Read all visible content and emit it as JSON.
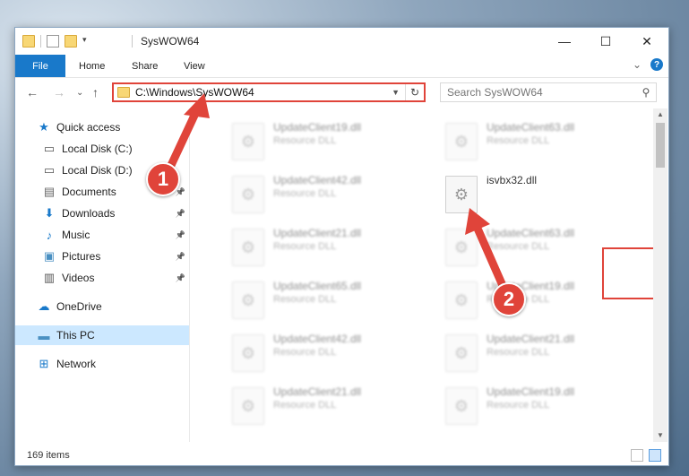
{
  "window": {
    "title": "SysWOW64",
    "controls": {
      "minimize": "—",
      "maximize": "☐",
      "close": "✕"
    }
  },
  "ribbon": {
    "tabs": [
      "File",
      "Home",
      "Share",
      "View"
    ],
    "collapse_glyph": "⌄",
    "help_glyph": "?"
  },
  "navigation": {
    "back": "←",
    "forward": "→",
    "recent": "⌄",
    "up": "↑",
    "address_path": "C:\\Windows\\SysWOW64",
    "search_placeholder": "Search SysWOW64"
  },
  "sidebar": {
    "items": [
      {
        "label": "Quick access",
        "icon": "star-icon",
        "pinned": false
      },
      {
        "label": "Local Disk (C:)",
        "icon": "drive-icon",
        "pinned": false
      },
      {
        "label": "Local Disk (D:)",
        "icon": "drive-icon",
        "pinned": false
      },
      {
        "label": "Documents",
        "icon": "documents-icon",
        "pinned": true
      },
      {
        "label": "Downloads",
        "icon": "download-icon",
        "pinned": true
      },
      {
        "label": "Music",
        "icon": "music-icon",
        "pinned": true
      },
      {
        "label": "Pictures",
        "icon": "pictures-icon",
        "pinned": true
      },
      {
        "label": "Videos",
        "icon": "videos-icon",
        "pinned": true
      },
      {
        "label": "OneDrive",
        "icon": "cloud-icon",
        "pinned": false
      },
      {
        "label": "This PC",
        "icon": "computer-icon",
        "pinned": false,
        "selected": true
      },
      {
        "label": "Network",
        "icon": "network-icon",
        "pinned": false
      }
    ]
  },
  "files": [
    {
      "name": "UpdateClient19.dll",
      "type": "Resource DLL",
      "blurred": true
    },
    {
      "name": "UpdateClient63.dll",
      "type": "Resource DLL",
      "blurred": true
    },
    {
      "name": "UpdateClient42.dll",
      "type": "Resource DLL",
      "blurred": true
    },
    {
      "name": "isvbx32.dll",
      "type": "",
      "blurred": false,
      "highlighted": true
    },
    {
      "name": "UpdateClient21.dll",
      "type": "Resource DLL",
      "blurred": true
    },
    {
      "name": "UpdateClient63.dll",
      "type": "Resource DLL",
      "blurred": true
    },
    {
      "name": "UpdateClient65.dll",
      "type": "Resource DLL",
      "blurred": true
    },
    {
      "name": "UpdateClient19.dll",
      "type": "Resource DLL",
      "blurred": true
    },
    {
      "name": "UpdateClient42.dll",
      "type": "Resource DLL",
      "blurred": true
    },
    {
      "name": "UpdateClient21.dll",
      "type": "Resource DLL",
      "blurred": true
    },
    {
      "name": "UpdateClient21.dll",
      "type": "Resource DLL",
      "blurred": true
    },
    {
      "name": "UpdateClient19.dll",
      "type": "Resource DLL",
      "blurred": true
    }
  ],
  "status": {
    "item_count": "169 items"
  },
  "annotations": {
    "step1": "1",
    "step2": "2",
    "color": "#e0443a"
  }
}
